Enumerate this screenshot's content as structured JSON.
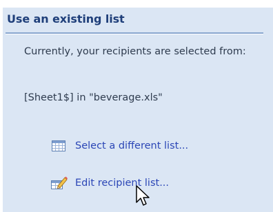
{
  "task_pane": {
    "section_title": "Use an existing list",
    "description": "Currently, your recipients are selected from:",
    "source": "[Sheet1$] in \"beverage.xls\"",
    "links": [
      {
        "label": "Select a different list...",
        "icon": "table-icon"
      },
      {
        "label": "Edit recipient list...",
        "icon": "edit-list-icon"
      }
    ]
  },
  "colors": {
    "pane_background": "#dbe6f4",
    "header_text": "#1f3f7a",
    "link_text": "#2b46b6",
    "body_text": "#2e3b4e"
  },
  "cursor": "pointer-arrow-icon"
}
